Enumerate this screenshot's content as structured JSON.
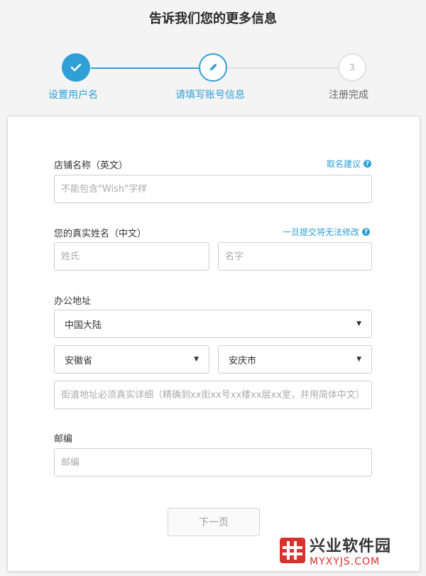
{
  "page": {
    "title": "告诉我们您的更多信息"
  },
  "steps": [
    {
      "label": "设置用户名",
      "state": "done",
      "icon": "check-icon"
    },
    {
      "label": "请填写账号信息",
      "state": "active",
      "icon": "pencil-icon"
    },
    {
      "label": "注册完成",
      "state": "pending",
      "number": "3"
    }
  ],
  "form": {
    "store_name": {
      "label": "店铺名称（英文）",
      "help": "取名建议",
      "placeholder": "不能包含\"Wish\"字样",
      "value": ""
    },
    "real_name": {
      "label": "您的真实姓名（中文）",
      "help": "一旦提交将无法修改",
      "surname_placeholder": "姓氏",
      "given_placeholder": "名字"
    },
    "address": {
      "label": "办公地址",
      "country": "中国大陆",
      "province": "安徽省",
      "city": "安庆市",
      "street_placeholder": "街道地址必须真实详细（精确到xx街xx号xx楼xx层xx室，并用简体中文）"
    },
    "postal": {
      "label": "邮编",
      "placeholder": "邮编"
    },
    "next_button": "下一页"
  },
  "watermark": {
    "cn": "兴业软件园",
    "en": "MYXYJS.COM"
  },
  "colors": {
    "accent": "#2f9fd8",
    "inactive": "#e1e1e1",
    "brand_red": "#d8322f"
  }
}
